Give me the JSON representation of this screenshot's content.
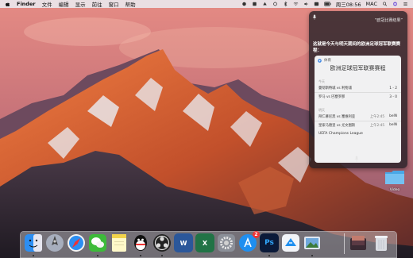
{
  "menubar": {
    "items": [
      "Finder",
      "文件",
      "编辑",
      "显示",
      "前往",
      "窗口",
      "帮助"
    ],
    "status": {
      "clock": "周三08:56",
      "user": "MAC"
    }
  },
  "siri": {
    "user_query": "“欧冠比赛结果”",
    "answer_text": "这就是今天与明天期间的欧洲足球冠军联赛赛程：",
    "card": {
      "source": "体育",
      "title": "欧洲足球冠军联赛赛程",
      "sections": [
        {
          "label": "今天",
          "matches": [
            {
              "teams": "曼彻斯特城 vs 利物浦",
              "time": "",
              "score": "1 - 2"
            },
            {
              "teams": "罗马 vs 巴塞罗那",
              "time": "",
              "score": "3 - 0"
            }
          ]
        },
        {
          "label": "明天",
          "matches": [
            {
              "teams": "拜仁慕尼黑 vs 塞维利亚",
              "time": "上午2:45",
              "score": "beIN"
            },
            {
              "teams": "皇家马德里 vs 尤文图斯",
              "time": "上午2:45",
              "score": "beIN"
            }
          ]
        }
      ],
      "footer": "UEFA Champions League"
    }
  },
  "desktop": {
    "folder_label": "Video"
  },
  "dock": {
    "apps": [
      "finder",
      "launchpad",
      "safari",
      "wechat",
      "notes",
      "qq",
      "obs",
      "word",
      "excel",
      "system-preferences",
      "app-store",
      "photoshop",
      "xcode",
      "preview",
      "downloads",
      "trash"
    ],
    "text_icons": {
      "word": "W",
      "excel": "X",
      "photoshop": "Ps",
      "app_store_badge": "2"
    }
  },
  "colors": {
    "menubar_bg": "#ebebf0",
    "siri_bg": "#201e24",
    "card_bg": "#f1f1f2",
    "word": "#2b579a",
    "excel": "#217346",
    "photoshop": "#0b1a39"
  }
}
